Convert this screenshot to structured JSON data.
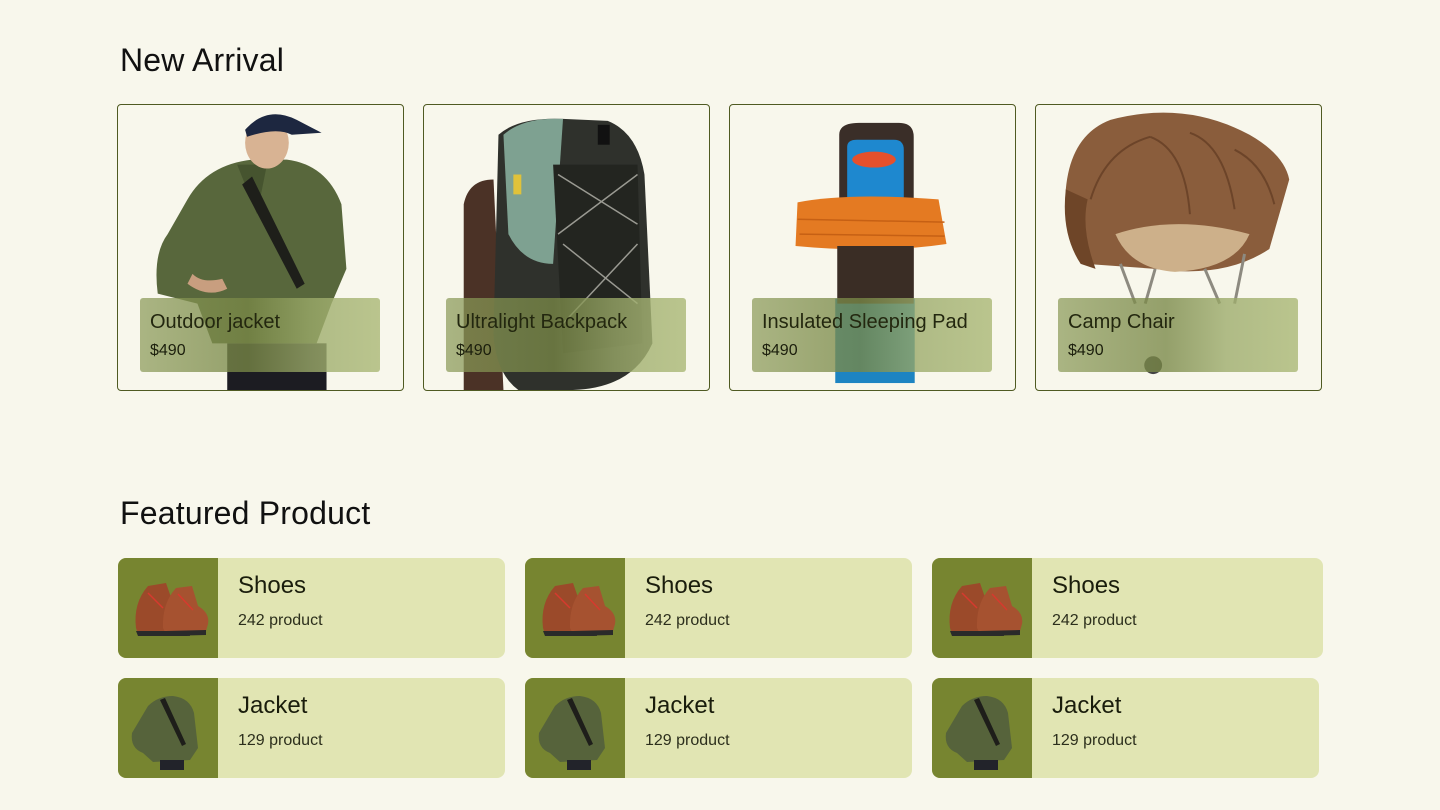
{
  "new_arrival": {
    "title": "New Arrival",
    "items": [
      {
        "name": "Outdoor jacket",
        "price": "$490",
        "image": "man-in-green-jacket-photo"
      },
      {
        "name": "Ultralight Backpack",
        "price": "$490",
        "image": "backpack-photo"
      },
      {
        "name": "Insulated Sleeping Pad",
        "price": "$490",
        "image": "sleeping-bag-photo"
      },
      {
        "name": "Camp Chair",
        "price": "$490",
        "image": "camp-chair-photo"
      }
    ]
  },
  "featured": {
    "title": "Featured Product",
    "categories": [
      {
        "name": "Shoes",
        "count": "242 product",
        "image": "hiking-boots-photo"
      },
      {
        "name": "Shoes",
        "count": "242 product",
        "image": "hiking-boots-photo"
      },
      {
        "name": "Shoes",
        "count": "242 product",
        "image": "hiking-boots-photo"
      },
      {
        "name": "Jacket",
        "count": "129 product",
        "image": "jacket-photo"
      },
      {
        "name": "Jacket",
        "count": "129 product",
        "image": "jacket-photo"
      },
      {
        "name": "Jacket",
        "count": "129 product",
        "image": "jacket-photo"
      }
    ]
  },
  "colors": {
    "background": "#f8f7ec",
    "card_border": "#4f5a22",
    "category_card": "#e1e5b3",
    "category_thumb": "#778530"
  }
}
